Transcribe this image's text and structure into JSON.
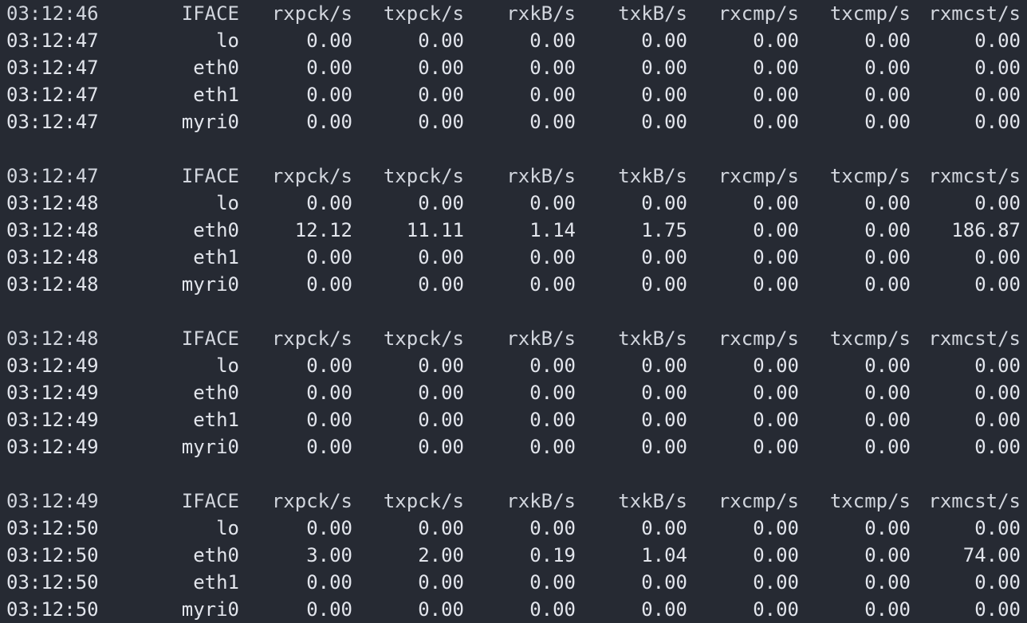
{
  "columns": [
    "IFACE",
    "rxpck/s",
    "txpck/s",
    "rxkB/s",
    "txkB/s",
    "rxcmp/s",
    "txcmp/s",
    "rxmcst/s"
  ],
  "blocks": [
    {
      "header_time": "03:12:46",
      "rows": [
        [
          "03:12:47",
          "lo",
          "0.00",
          "0.00",
          "0.00",
          "0.00",
          "0.00",
          "0.00",
          "0.00"
        ],
        [
          "03:12:47",
          "eth0",
          "0.00",
          "0.00",
          "0.00",
          "0.00",
          "0.00",
          "0.00",
          "0.00"
        ],
        [
          "03:12:47",
          "eth1",
          "0.00",
          "0.00",
          "0.00",
          "0.00",
          "0.00",
          "0.00",
          "0.00"
        ],
        [
          "03:12:47",
          "myri0",
          "0.00",
          "0.00",
          "0.00",
          "0.00",
          "0.00",
          "0.00",
          "0.00"
        ]
      ]
    },
    {
      "header_time": "03:12:47",
      "rows": [
        [
          "03:12:48",
          "lo",
          "0.00",
          "0.00",
          "0.00",
          "0.00",
          "0.00",
          "0.00",
          "0.00"
        ],
        [
          "03:12:48",
          "eth0",
          "12.12",
          "11.11",
          "1.14",
          "1.75",
          "0.00",
          "0.00",
          "186.87"
        ],
        [
          "03:12:48",
          "eth1",
          "0.00",
          "0.00",
          "0.00",
          "0.00",
          "0.00",
          "0.00",
          "0.00"
        ],
        [
          "03:12:48",
          "myri0",
          "0.00",
          "0.00",
          "0.00",
          "0.00",
          "0.00",
          "0.00",
          "0.00"
        ]
      ]
    },
    {
      "header_time": "03:12:48",
      "rows": [
        [
          "03:12:49",
          "lo",
          "0.00",
          "0.00",
          "0.00",
          "0.00",
          "0.00",
          "0.00",
          "0.00"
        ],
        [
          "03:12:49",
          "eth0",
          "0.00",
          "0.00",
          "0.00",
          "0.00",
          "0.00",
          "0.00",
          "0.00"
        ],
        [
          "03:12:49",
          "eth1",
          "0.00",
          "0.00",
          "0.00",
          "0.00",
          "0.00",
          "0.00",
          "0.00"
        ],
        [
          "03:12:49",
          "myri0",
          "0.00",
          "0.00",
          "0.00",
          "0.00",
          "0.00",
          "0.00",
          "0.00"
        ]
      ]
    },
    {
      "header_time": "03:12:49",
      "rows": [
        [
          "03:12:50",
          "lo",
          "0.00",
          "0.00",
          "0.00",
          "0.00",
          "0.00",
          "0.00",
          "0.00"
        ],
        [
          "03:12:50",
          "eth0",
          "3.00",
          "2.00",
          "0.19",
          "1.04",
          "0.00",
          "0.00",
          "74.00"
        ],
        [
          "03:12:50",
          "eth1",
          "0.00",
          "0.00",
          "0.00",
          "0.00",
          "0.00",
          "0.00",
          "0.00"
        ],
        [
          "03:12:50",
          "myri0",
          "0.00",
          "0.00",
          "0.00",
          "0.00",
          "0.00",
          "0.00",
          "0.00"
        ]
      ]
    }
  ]
}
